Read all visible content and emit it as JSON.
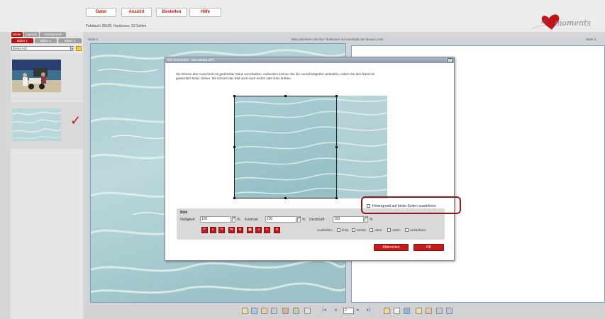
{
  "colors": {
    "accent": "#b51212",
    "panel_bg": "#e6e6e6",
    "dialog_title": "#8c9ab0",
    "highlight": "#8a1c1c",
    "water_light": "#c3dfe2",
    "water_dark": "#9fc6cb"
  },
  "menu": {
    "datei": "Datei",
    "ansicht": "Ansicht",
    "bestellen": "Bestellen",
    "hilfe": "Hilfe"
  },
  "fotobuch_info": "Fotobuch 28x28, Hardcover, 52 Seiten",
  "logo": {
    "prefix": "my",
    "text": "moments"
  },
  "sidebar": {
    "tabs_top": [
      "Bilder",
      "Layouts",
      "Hintergründe"
    ],
    "tabs_sub": [
      "Bilder 1",
      "Bilder 2",
      "Bilder 3"
    ],
    "folder_select": "Demo HG",
    "arrow": "▾"
  },
  "canvas": {
    "left_page_label": "Seite 2",
    "hint": "Bitte platzieren Sie Ihre Textboxen nur innerhalb der blauen Linie.",
    "right_page_label": "Seite 3"
  },
  "dialog": {
    "title": "Bild bearbeiten - DSC06463.JPG",
    "close": "x",
    "description": "Sie können den Ausschnitt mit gedrückter Maus verschieben. Außerdem können Sie die Ausschnittgröße verändern, indem Sie den Rand mit gedrückter Maus ziehen. Sie können das Bild auch nach rechts oder links drehen.",
    "bg_extend_label": "Hintergrund auf beide Seiten ausdehnen",
    "section": "Bild",
    "helligkeit_label": "Helligkeit",
    "helligkeit_value": "100",
    "kontrast_label": "Kontrast",
    "kontrast_value": "100",
    "deckkraft_label": "Deckkraft",
    "deckkraft_value": "100",
    "percent": "%",
    "auslaufen_label": "Auslaufen:",
    "auslaufen_options": [
      "links",
      "rechts",
      "oben",
      "unten",
      "umlaufend"
    ],
    "cancel": "Abbrechen",
    "ok": "OK",
    "tool_icons": [
      "rotate-left-icon",
      "undo-icon",
      "redo-icon",
      "flip-horizontal-icon",
      "flip-vertical-icon",
      "crop-icon",
      "grayscale-icon",
      "sepia-icon",
      "delete-icon"
    ],
    "tool_glyphs": [
      "↶",
      "◐",
      "↷",
      "⇆",
      "⇅",
      "▣",
      "◑",
      "≈",
      "✕"
    ]
  },
  "toolbar": {
    "page_value": "2",
    "first": "|◂",
    "prev": "◂",
    "next": "▸",
    "last": "▸|"
  }
}
